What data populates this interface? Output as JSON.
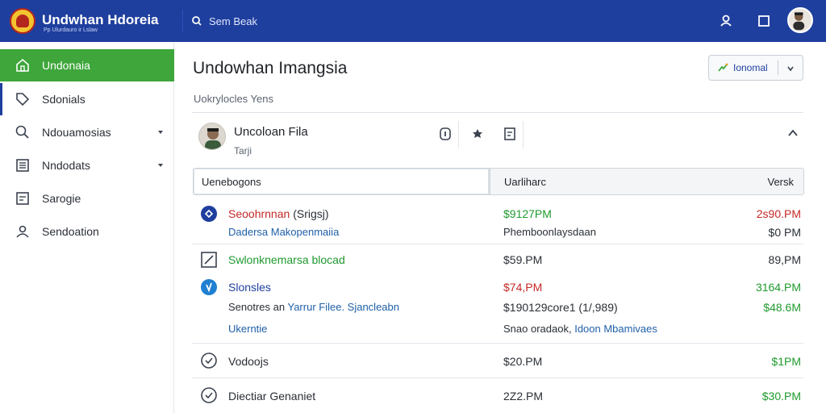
{
  "header": {
    "brand_title": "Undwhan Hdoreia",
    "brand_sub": "Pp Ulurdauro ir Lslaw",
    "search_label": "Sem Beak"
  },
  "sidebar": {
    "items": [
      {
        "label": "Undonaia",
        "icon": "home-icon",
        "active": true
      },
      {
        "label": "Sdonials",
        "icon": "tag-icon"
      },
      {
        "label": "Ndouamosias",
        "icon": "search-icon",
        "has_chevron": true
      },
      {
        "label": "Nndodats",
        "icon": "grid-icon",
        "has_chevron": true
      },
      {
        "label": "Sarogie",
        "icon": "document-icon"
      },
      {
        "label": "Sendoation",
        "icon": "users-icon"
      }
    ]
  },
  "main": {
    "title": "Undowhan Imangsia",
    "subtitle": "Uokrylocles  Yens",
    "dropdown_label": "Ionomal",
    "card": {
      "title": "Uncoloan Fila",
      "subtitle": "Tarji"
    },
    "table": {
      "col1_value": "Uenebogons",
      "col2_header": "Uarliharc",
      "col3_header": "Versk",
      "rows": [
        {
          "icon": "compass-icon",
          "name": "Seoohrnnan",
          "name_suffix": "(Srigsj)",
          "detail": "Dadersa Makopenmaiia",
          "col2": "$9127PM",
          "col2_sub": "Phemboonlaysdaan",
          "col3": "2s90.PM",
          "col3_sub": "$0 PM"
        },
        {
          "icon": "edit-icon",
          "name": "Swlonknemarsa blocad",
          "col2": "$59.PM",
          "col3": "89,PM"
        },
        {
          "icon": "shield-icon",
          "name": "Slonsles",
          "detail_prefix": "Senotres an",
          "detail_link": "Yarrur Filee. Sjancleabn",
          "detail_2": "Ukerntie",
          "col2": "$74,PM",
          "col2_sub": "$190129core1 (1/,989)",
          "col2_sub2": "Snao oradaok,",
          "col2_sub2_link": "Idoon Mbamivaes",
          "col3": "3164.PM",
          "col3_sub": "$48.6M"
        },
        {
          "icon": "check-circle-icon",
          "name": "Vodoojs",
          "col2": "$20.PM",
          "col3": "$1PM"
        },
        {
          "icon": "check-circle-icon",
          "name": "Diectiar Genaniet",
          "col2": "2Z2.PM",
          "col3": "$30.PM"
        }
      ]
    }
  }
}
